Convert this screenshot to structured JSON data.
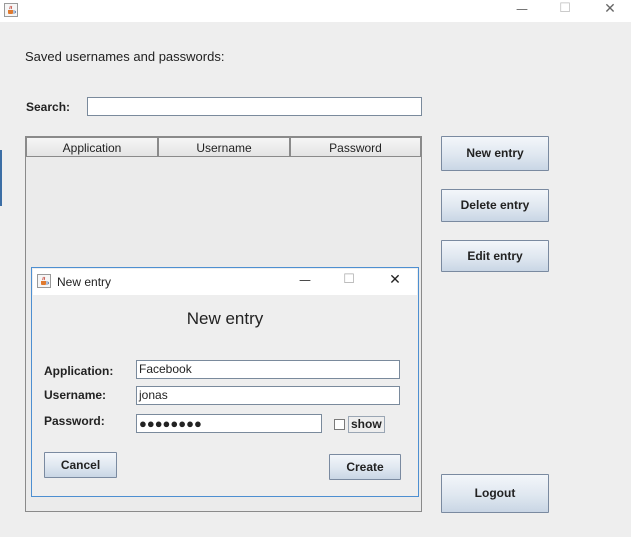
{
  "main": {
    "heading": "Saved usernames and passwords:",
    "search": {
      "label": "Search:",
      "value": ""
    },
    "table": {
      "columns": [
        "Application",
        "Username",
        "Password"
      ]
    },
    "buttons": {
      "new_entry": "New entry",
      "delete_entry": "Delete entry",
      "edit_entry": "Edit entry",
      "logout": "Logout"
    }
  },
  "window_controls": {
    "minimize": "—",
    "maximize": "☐",
    "close": "✕"
  },
  "dialog": {
    "title": "New entry",
    "heading": "New entry",
    "fields": {
      "application": {
        "label": "Application:",
        "value": "Facebook"
      },
      "username": {
        "label": "Username:",
        "value": "jonas"
      },
      "password": {
        "label": "Password:",
        "value": "●●●●●●●●"
      }
    },
    "show_label": "show",
    "buttons": {
      "cancel": "Cancel",
      "create": "Create"
    }
  },
  "colors": {
    "accent": "#4d8fd1",
    "window_bg": "#eeeeee"
  },
  "icons": {
    "app": "java-cup-icon"
  }
}
